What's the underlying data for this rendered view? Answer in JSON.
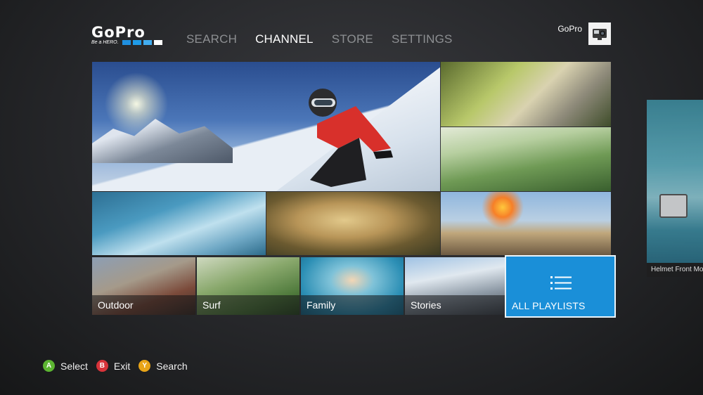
{
  "header": {
    "logo_text": "GoPro",
    "logo_tagline": "Be a HERO.",
    "nav": [
      {
        "label": "SEARCH",
        "active": false
      },
      {
        "label": "CHANNEL",
        "active": true
      },
      {
        "label": "STORE",
        "active": false
      },
      {
        "label": "SETTINGS",
        "active": false
      }
    ],
    "user": {
      "name": "GoPro",
      "avatar_icon": "gopro-camera-icon"
    }
  },
  "grid": {
    "featured_icon": "snowboarder-photo",
    "categories": [
      {
        "label": "Outdoor"
      },
      {
        "label": "Surf"
      },
      {
        "label": "Family"
      },
      {
        "label": "Stories"
      }
    ],
    "all_playlists": {
      "label": "ALL PLAYLISTS",
      "icon": "list-icon"
    }
  },
  "peek": {
    "label": "Helmet Front Mou"
  },
  "footer": {
    "hints": [
      {
        "button": "A",
        "label": "Select",
        "color": "#5cb531"
      },
      {
        "button": "B",
        "label": "Exit",
        "color": "#d8333a"
      },
      {
        "button": "Y",
        "label": "Search",
        "color": "#e8a418"
      }
    ]
  },
  "colors": {
    "accent": "#1a8fd8",
    "nav_inactive": "#8d8f92"
  }
}
